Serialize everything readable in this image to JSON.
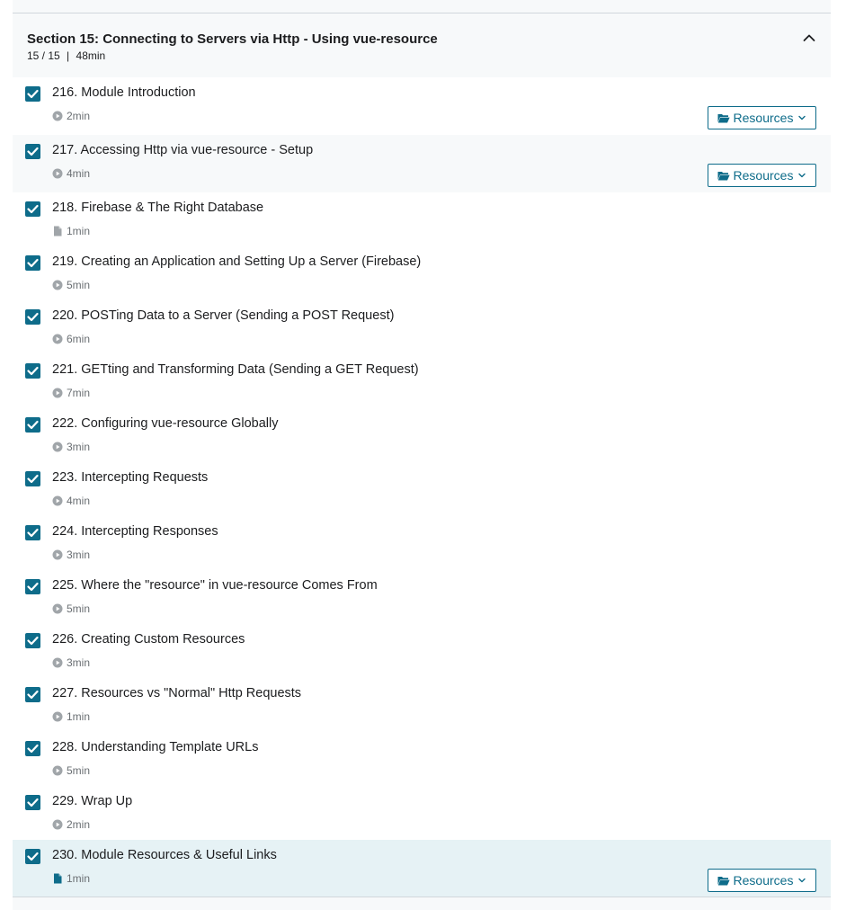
{
  "section": {
    "title": "Section 15: Connecting to Servers via Http - Using vue-resource",
    "progress": "15 / 15",
    "separator": "|",
    "duration": "48min",
    "expanded": true
  },
  "colors": {
    "accent": "#0e6c8a",
    "checkbox_fill": "#0e6c8a",
    "active_row": "#e6f2f5",
    "hover_row": "#f7f9fa",
    "muted_text": "#6a6f73"
  },
  "resources_label": "Resources",
  "lessons": [
    {
      "title": "216. Module Introduction",
      "duration": "2min",
      "type": "video",
      "completed": true,
      "has_resources": true
    },
    {
      "title": "217. Accessing Http via vue-resource - Setup",
      "duration": "4min",
      "type": "video",
      "completed": true,
      "has_resources": true
    },
    {
      "title": "218. Firebase & The Right Database",
      "duration": "1min",
      "type": "article",
      "completed": true,
      "has_resources": false
    },
    {
      "title": "219. Creating an Application and Setting Up a Server (Firebase)",
      "duration": "5min",
      "type": "video",
      "completed": true,
      "has_resources": false
    },
    {
      "title": "220. POSTing Data to a Server (Sending a POST Request)",
      "duration": "6min",
      "type": "video",
      "completed": true,
      "has_resources": false
    },
    {
      "title": "221. GETting and Transforming Data (Sending a GET Request)",
      "duration": "7min",
      "type": "video",
      "completed": true,
      "has_resources": false
    },
    {
      "title": "222. Configuring vue-resource Globally",
      "duration": "3min",
      "type": "video",
      "completed": true,
      "has_resources": false
    },
    {
      "title": "223. Intercepting Requests",
      "duration": "4min",
      "type": "video",
      "completed": true,
      "has_resources": false
    },
    {
      "title": "224. Intercepting Responses",
      "duration": "3min",
      "type": "video",
      "completed": true,
      "has_resources": false
    },
    {
      "title": "225. Where the \"resource\" in vue-resource Comes From",
      "duration": "5min",
      "type": "video",
      "completed": true,
      "has_resources": false
    },
    {
      "title": "226. Creating Custom Resources",
      "duration": "3min",
      "type": "video",
      "completed": true,
      "has_resources": false
    },
    {
      "title": "227. Resources vs \"Normal\" Http Requests",
      "duration": "1min",
      "type": "video",
      "completed": true,
      "has_resources": false
    },
    {
      "title": "228. Understanding Template URLs",
      "duration": "5min",
      "type": "video",
      "completed": true,
      "has_resources": false
    },
    {
      "title": "229. Wrap Up",
      "duration": "2min",
      "type": "video",
      "completed": true,
      "has_resources": false
    },
    {
      "title": "230. Module Resources & Useful Links",
      "duration": "1min",
      "type": "article",
      "completed": true,
      "has_resources": true,
      "active": true
    }
  ]
}
